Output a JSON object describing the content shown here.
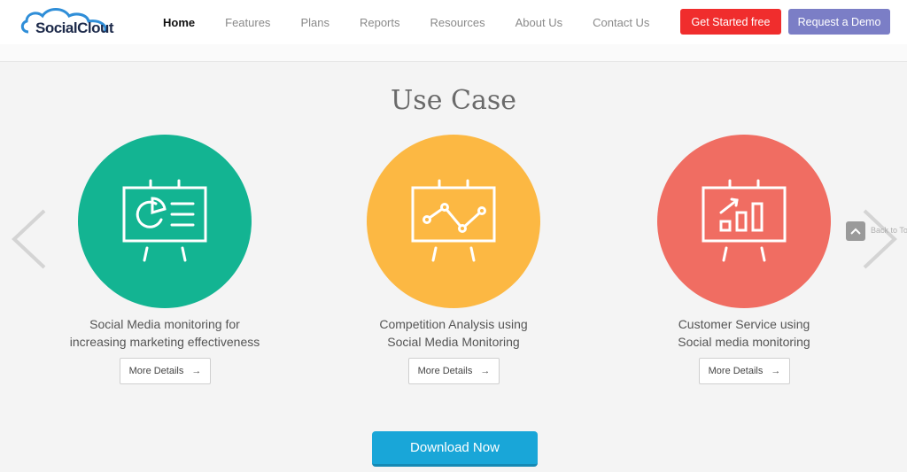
{
  "header": {
    "logo_text": "SocialClout",
    "nav": [
      {
        "label": "Home",
        "active": true
      },
      {
        "label": "Features",
        "active": false
      },
      {
        "label": "Plans",
        "active": false
      },
      {
        "label": "Reports",
        "active": false
      },
      {
        "label": "Resources",
        "active": false
      },
      {
        "label": "About Us",
        "active": false
      },
      {
        "label": "Contact Us",
        "active": false
      }
    ],
    "cta_primary": "Get Started free",
    "cta_secondary": "Request a Demo"
  },
  "use_case": {
    "title": "Use Case",
    "cards": [
      {
        "line1": "Social Media monitoring for",
        "line2": "increasing marketing effectiveness",
        "button": "More Details",
        "color": "#13b492",
        "icon": "pie-chart-board-icon"
      },
      {
        "line1": "Competition Analysis using",
        "line2": "Social Media Monitoring",
        "button": "More Details",
        "color": "#fcb843",
        "icon": "line-graph-board-icon"
      },
      {
        "line1": "Customer Service using",
        "line2": "Social media monitoring",
        "button": "More Details",
        "color": "#f06d62",
        "icon": "bar-chart-board-icon"
      }
    ]
  },
  "back_to_top": "Back to Top",
  "download_button": "Download Now",
  "colors": {
    "primary_cta": "#f02d2d",
    "secondary_cta": "#7b7ec6",
    "download": "#19a6d8"
  }
}
